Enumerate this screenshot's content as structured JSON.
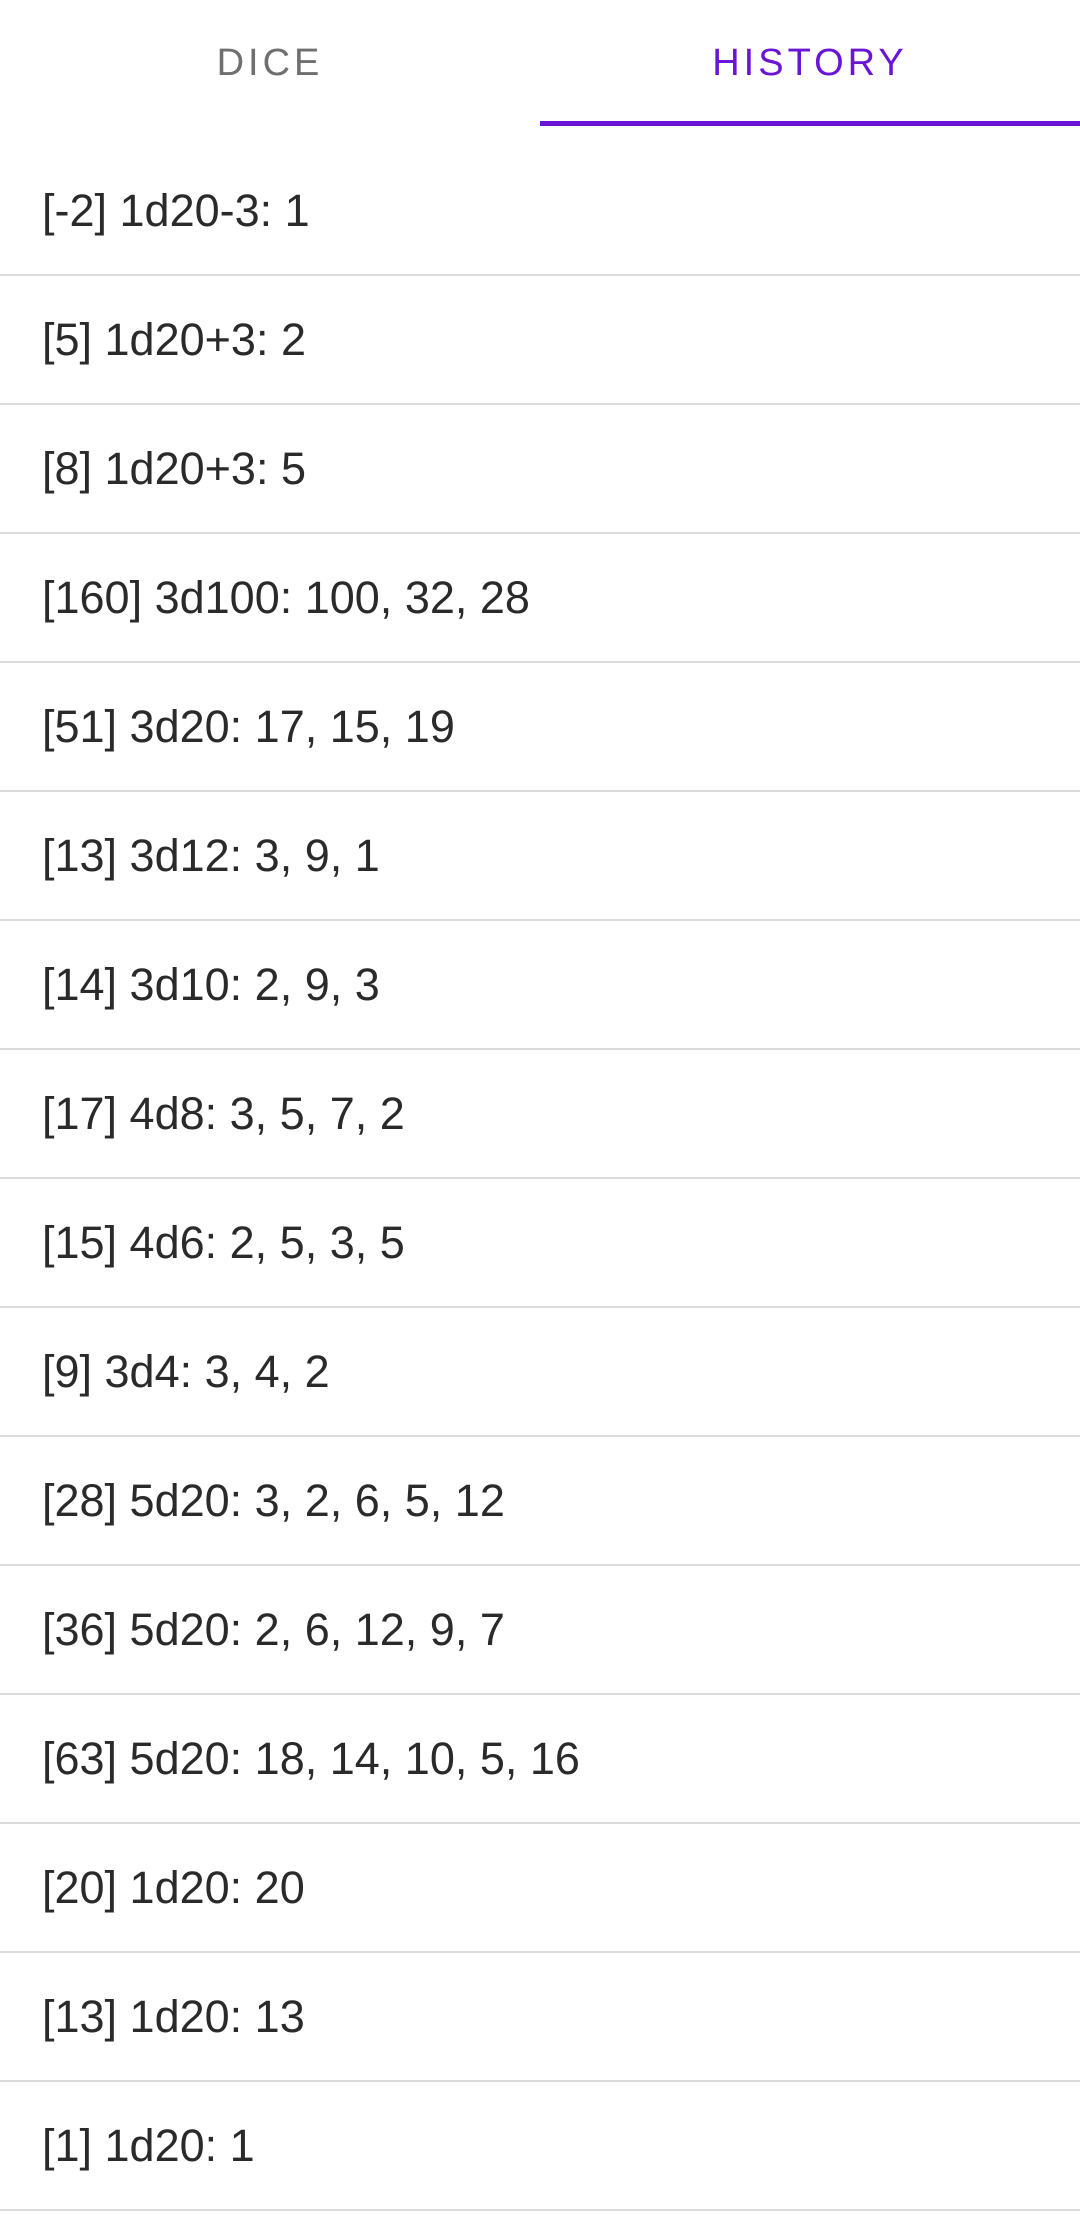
{
  "tabs": [
    {
      "label": "DICE",
      "active": false
    },
    {
      "label": "HISTORY",
      "active": true
    }
  ],
  "colors": {
    "accent": "#6a14d6",
    "inactive_tab": "#6f6f6f",
    "divider": "#dcdcdc",
    "text": "#2a2a2a"
  },
  "history": [
    "[-2] 1d20-3: 1",
    "[5] 1d20+3: 2",
    "[8] 1d20+3: 5",
    "[160] 3d100: 100, 32, 28",
    "[51] 3d20: 17, 15, 19",
    "[13] 3d12: 3, 9, 1",
    "[14] 3d10: 2, 9, 3",
    "[17] 4d8: 3, 5, 7, 2",
    "[15] 4d6: 2, 5, 3, 5",
    "[9] 3d4: 3, 4, 2",
    "[28] 5d20: 3, 2, 6, 5, 12",
    "[36] 5d20: 2, 6, 12, 9, 7",
    "[63] 5d20: 18, 14, 10, 5, 16",
    "[20] 1d20: 20",
    "[13] 1d20: 13",
    "[1] 1d20: 1"
  ]
}
